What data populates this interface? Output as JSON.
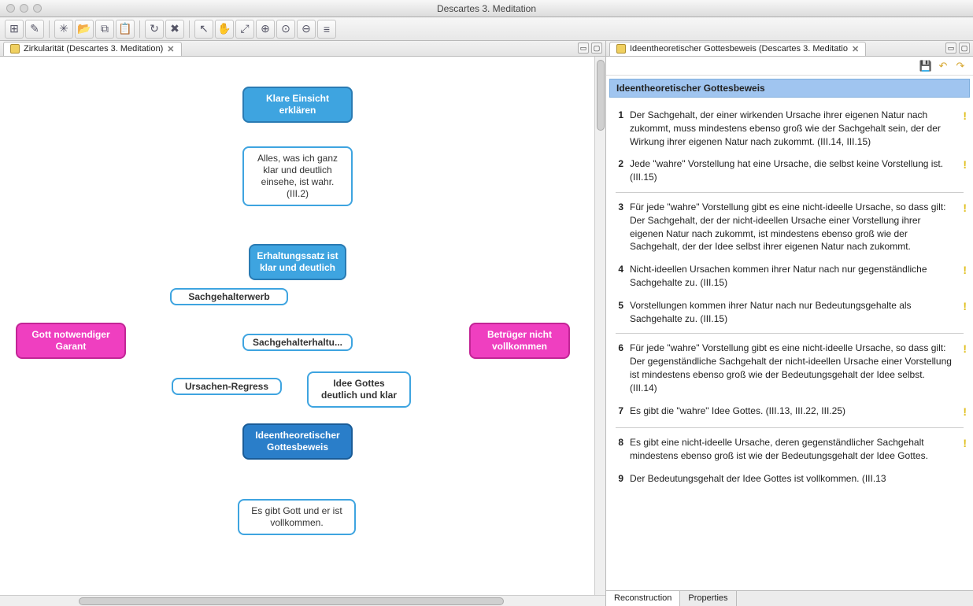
{
  "window": {
    "title": "Descartes 3. Meditation"
  },
  "left_tab": {
    "label": "Zirkularität (Descartes 3. Meditation)"
  },
  "right_tab": {
    "label": "Ideentheoretischer Gottesbeweis (Descartes 3. Meditatio"
  },
  "diagram": {
    "n1": "Klare Einsicht erklären",
    "n2": "Alles, was ich ganz klar und deutlich einsehe, ist wahr. (III.2)",
    "n3": "Erhaltungssatz ist klar und deutlich",
    "n4": "Sachgehalterwerb",
    "n5": "Sachgehalterhaltu...",
    "n6": "Ursachen-Regress",
    "n7": "Idee Gottes deutlich und klar",
    "n8": "Ideentheoretischer Gottesbeweis",
    "n9": "Es gibt Gott und er ist vollkommen.",
    "n10": "Gott notwendiger Garant",
    "n11": "Betrüger nicht vollkommen"
  },
  "right_panel": {
    "title": "Ideentheoretischer Gottesbeweis",
    "items": [
      {
        "n": "1",
        "t": "Der Sachgehalt, der einer wirkenden Ursache ihrer eigenen Natur nach zukommt, muss mindestens ebenso groß wie der Sachgehalt sein, der der Wirkung ihrer eigenen Natur nach zukommt. (III.14, III.15)"
      },
      {
        "n": "2",
        "t": "Jede \"wahre\" Vorstellung hat eine Ursache, die selbst keine Vorstellung ist. (III.15)"
      },
      {
        "n": "3",
        "t": "Für jede \"wahre\" Vorstellung gibt es eine nicht-ideelle Ursache, so dass gilt: Der Sachgehalt, der der nicht-ideellen Ursache einer Vorstellung ihrer eigenen Natur nach zukommt, ist mindestens ebenso groß wie der Sachgehalt, der der Idee selbst ihrer eigenen Natur nach zukommt."
      },
      {
        "n": "4",
        "t": "Nicht-ideellen Ursachen kommen ihrer Natur nach nur gegenständliche Sachgehalte zu. (III.15)"
      },
      {
        "n": "5",
        "t": "Vorstellungen kommen ihrer Natur nach nur Bedeutungsgehalte als Sachgehalte zu. (III.15)"
      },
      {
        "n": "6",
        "t": "Für jede \"wahre\" Vorstellung gibt es eine nicht-ideelle Ursache, so dass gilt: Der gegenständliche Sachgehalt der nicht-ideellen Ursache einer Vorstellung ist mindestens ebenso groß wie der Bedeutungsgehalt der Idee selbst. (III.14)"
      },
      {
        "n": "7",
        "t": "Es gibt die \"wahre\" Idee Gottes. (III.13, III.22, III.25)"
      },
      {
        "n": "8",
        "t": "Es gibt eine nicht-ideelle Ursache, deren gegenständlicher Sachgehalt mindestens ebenso groß ist wie der Bedeutungsgehalt der Idee Gottes."
      },
      {
        "n": "9",
        "t": "Der Bedeutungsgehalt der Idee Gottes ist vollkommen. (III.13"
      }
    ]
  },
  "bottom_tabs": {
    "a": "Reconstruction",
    "b": "Properties"
  }
}
